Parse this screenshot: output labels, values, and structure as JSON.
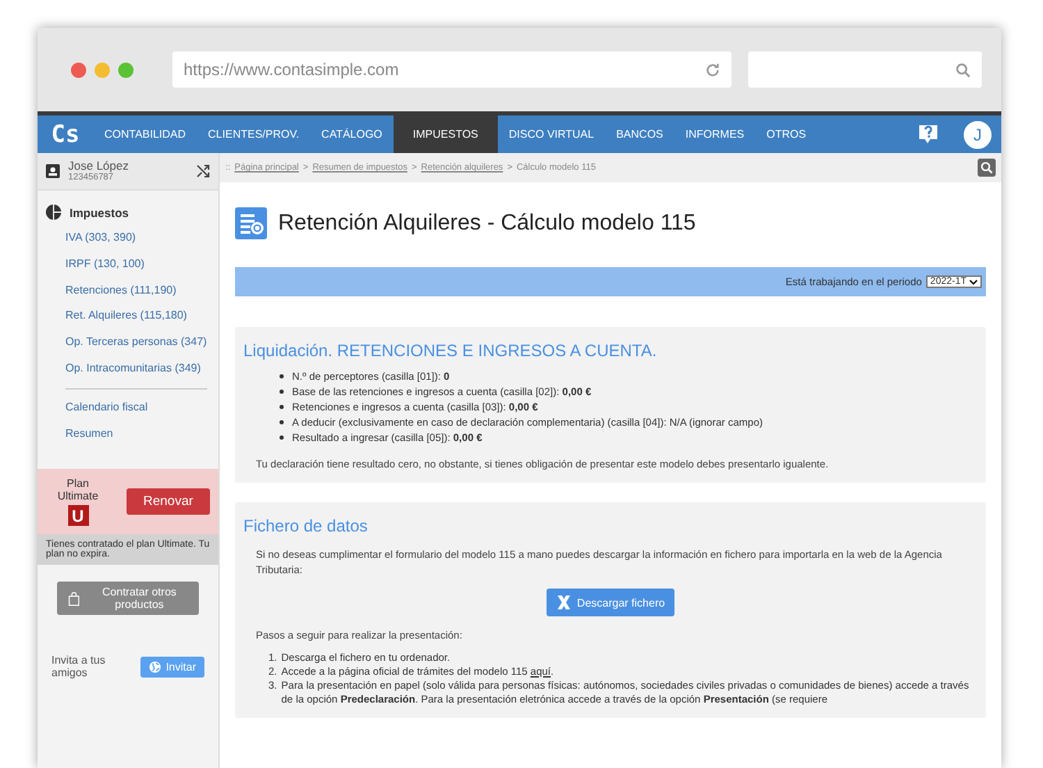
{
  "browser": {
    "url": "https://www.contasimple.com"
  },
  "nav": {
    "logo": "Cs",
    "items": [
      {
        "label": "CONTABILIDAD",
        "selected": false
      },
      {
        "label": "CLIENTES/PROV.",
        "selected": false
      },
      {
        "label": "CATÁLOGO",
        "selected": false
      },
      {
        "label": "IMPUESTOS",
        "selected": true
      },
      {
        "label": "DISCO VIRTUAL",
        "selected": false
      },
      {
        "label": "BANCOS",
        "selected": false
      },
      {
        "label": "INFORMES",
        "selected": false
      },
      {
        "label": "OTROS",
        "selected": false
      }
    ],
    "avatar": "J"
  },
  "sidebar": {
    "user": {
      "name": "Jose López",
      "id": "123456787"
    },
    "section": "Impuestos",
    "groups": [
      [
        {
          "label": "IVA (303, 390)"
        },
        {
          "label": "IRPF (130, 100)"
        },
        {
          "label": "Retenciones (111,190)"
        },
        {
          "label": "Ret. Alquileres (115,180)"
        },
        {
          "label": "Op. Terceras personas (347)"
        },
        {
          "label": "Op. Intracomunitarias (349)"
        }
      ],
      [
        {
          "label": "Calendario fiscal"
        },
        {
          "label": "Resumen"
        }
      ]
    ],
    "plan": {
      "label": "Plan",
      "name": "Ultimate",
      "badge": "U",
      "button": "Renovar",
      "note": "Tienes contratado el plan Ultimate. Tu plan no expira."
    },
    "products_button": "Contratar otros productos",
    "invite": {
      "text": "Invita a tus amigos",
      "button": "Invitar"
    }
  },
  "breadcrumb": [
    {
      "text": "::",
      "kind": "text"
    },
    {
      "text": "Página principal",
      "kind": "link"
    },
    {
      "text": ">",
      "kind": "text"
    },
    {
      "text": "Resumen de impuestos",
      "kind": "link"
    },
    {
      "text": ">",
      "kind": "text"
    },
    {
      "text": "Retención alquileres",
      "kind": "link"
    },
    {
      "text": ">",
      "kind": "text"
    },
    {
      "text": "Cálculo modelo 115",
      "kind": "text"
    }
  ],
  "title": "Retención Alquileres - Cálculo modelo 115",
  "period": {
    "label": "Está trabajando en el periodo",
    "value": "2022-1T"
  },
  "liquidacion": {
    "heading": "Liquidación. RETENCIONES E INGRESOS A CUENTA.",
    "items": [
      "N.º de perceptores (casilla [01]): **0**",
      "Base de las retenciones e ingresos a cuenta (casilla [02]): **0,00 €**",
      "Retenciones e ingresos a cuenta (casilla [03]): **0,00 €**",
      "A deducir (exclusivamente en caso de declaración complementaria) (casilla [04]): N/A (ignorar campo)",
      "Resultado a ingresar (casilla [05]): **0,00 €**"
    ],
    "note": "Tu declaración tiene resultado cero, no obstante, si tienes obligación de presentar este modelo debes presentarlo igualente."
  },
  "fichero": {
    "heading": "Fichero de datos",
    "intro": "Si no deseas cumplimentar el formulario del modelo 115 a mano puedes descargar la información en fichero para importarla en la web de la Agencia Tributaria:",
    "button": "Descargar fichero",
    "steps_intro": "Pasos a seguir para realizar la presentación:",
    "steps": [
      {
        "number": "1.",
        "text": "Descarga el fichero en tu ordenador."
      },
      {
        "number": "2.",
        "text": "Accede a la página oficial de trámites del modelo 115",
        "link": "aquí",
        "after": "."
      },
      {
        "number": "3.",
        "text": "Para la presentación en papel (solo válida para personas físicas: autónomos, sociedades civiles privadas o comunidades de bienes) accede a través de la opción **Predeclaración**. Para la presentación eletrónica accede a través de la opción **Presentación** (se requiere"
      }
    ]
  }
}
